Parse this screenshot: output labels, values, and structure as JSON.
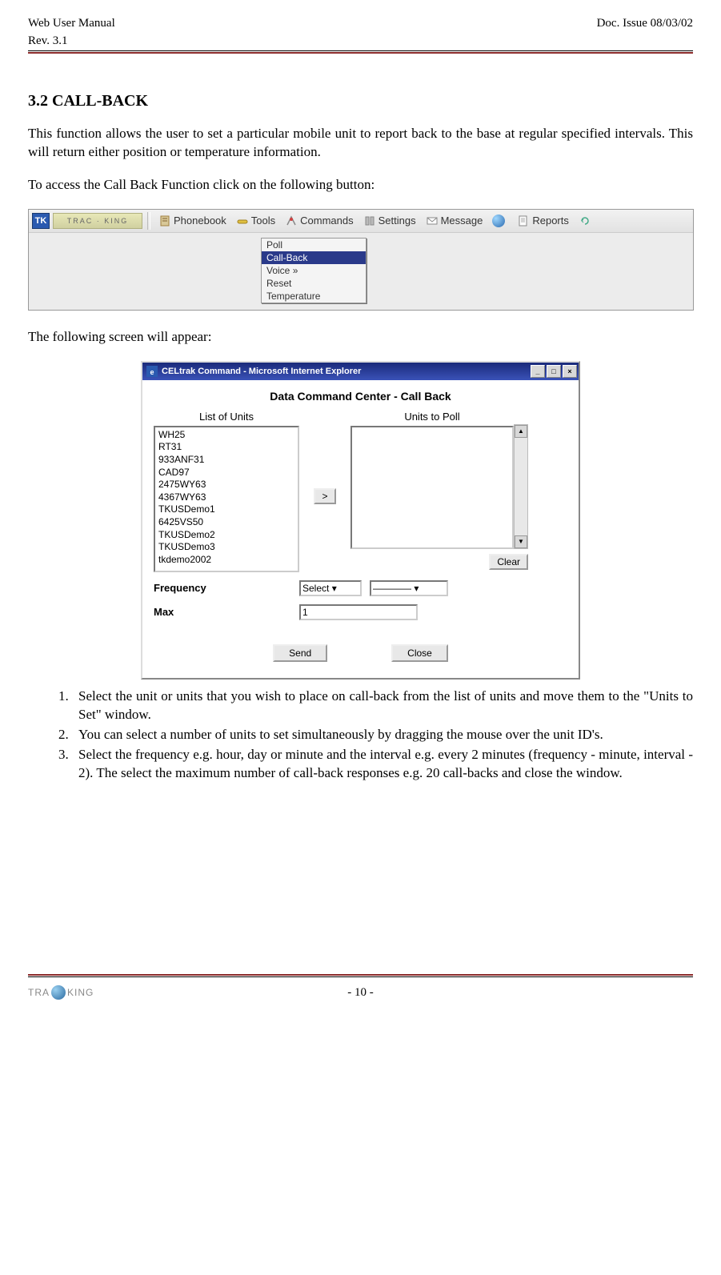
{
  "header": {
    "left_top": "Web User Manual",
    "left_bottom": "Rev. 3.1",
    "right_top": "Doc. Issue 08/03/02"
  },
  "section": {
    "number": "3.2",
    "title_rest": "CALL-BACK"
  },
  "para1": "This function allows the user to set a particular mobile unit to report back to the base at regular specified intervals.  This will return either position or temperature information.",
  "para2": "To access the Call Back Function click on the following button:",
  "para3": "The following screen will appear:",
  "toolbar": {
    "logo_letter": "TK",
    "brand": "TRAC · KING",
    "items": [
      "Phonebook",
      "Tools",
      "Commands",
      "Settings",
      "Message",
      "",
      "Reports"
    ],
    "menu": [
      "Poll",
      "Call-Back",
      "Voice  »",
      "Reset",
      "Temperature"
    ],
    "menu_selected_index": 1
  },
  "dialog": {
    "titlebar": "CELtrak Command - Microsoft Internet Explorer",
    "heading": "Data Command Center - Call Back",
    "list_label": "List of Units",
    "poll_label": "Units to Poll",
    "units": [
      "WH25",
      "RT31",
      "933ANF31",
      "CAD97",
      "2475WY63",
      "4367WY63",
      "TKUSDemo1",
      "6425VS50",
      "TKUSDemo2",
      "TKUSDemo3",
      "tkdemo2002"
    ],
    "arrow": ">",
    "clear": "Clear",
    "freq_label": "Frequency",
    "freq_select": "Select",
    "freq_dash": "————",
    "max_label": "Max",
    "max_value": "1",
    "send": "Send",
    "close": "Close"
  },
  "steps": [
    "Select the unit or units that you wish to place on call-back from the list of units and move them to the \"Units to Set\" window.",
    "You can select a number of units to set simultaneously by dragging the mouse over the unit ID's.",
    "Select the frequency e.g. hour, day or minute and the interval e.g. every 2 minutes (frequency - minute, interval - 2).  The select the maximum number of call-back responses e.g. 20 call-backs and close the window."
  ],
  "footer": {
    "logo_pre": "TRA",
    "logo_post": "KING",
    "page": "- 10 -"
  }
}
